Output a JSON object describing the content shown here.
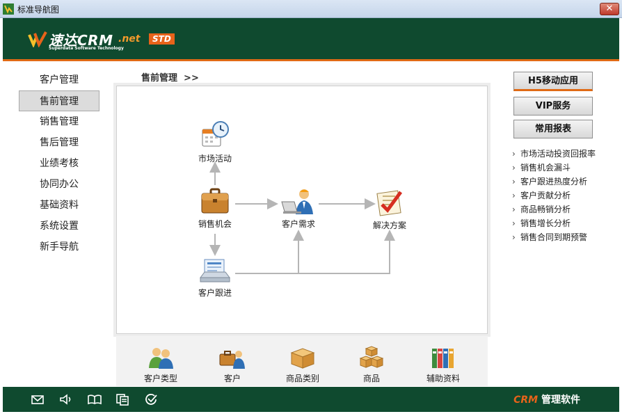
{
  "window": {
    "title": "标准导航图",
    "close_glyph": "✕"
  },
  "header": {
    "brand": "速达CRM",
    "brand_suffix": ".net",
    "edition": "STD",
    "tagline": "Superdata Software Technology"
  },
  "sidebar": {
    "items": [
      {
        "label": "客户管理"
      },
      {
        "label": "售前管理"
      },
      {
        "label": "销售管理"
      },
      {
        "label": "售后管理"
      },
      {
        "label": "业绩考核"
      },
      {
        "label": "协同办公"
      },
      {
        "label": "基础资料"
      },
      {
        "label": "系统设置"
      },
      {
        "label": "新手导航"
      }
    ],
    "active_index": 1
  },
  "breadcrumb": {
    "text": "售前管理  >>"
  },
  "flow": {
    "nodes": [
      {
        "label": "市场活动",
        "icon": "calendar-clock-icon"
      },
      {
        "label": "销售机会",
        "icon": "briefcase-icon"
      },
      {
        "label": "客户需求",
        "icon": "user-laptop-icon"
      },
      {
        "label": "解决方案",
        "icon": "checklist-icon"
      },
      {
        "label": "客户跟进",
        "icon": "document-stack-icon"
      }
    ]
  },
  "shortcuts": [
    {
      "label": "客户类型",
      "icon": "users-icon"
    },
    {
      "label": "客户",
      "icon": "customer-icon"
    },
    {
      "label": "商品类别",
      "icon": "box-icon"
    },
    {
      "label": "商品",
      "icon": "boxes-icon"
    },
    {
      "label": "辅助资料",
      "icon": "binders-icon"
    }
  ],
  "right": {
    "buttons": [
      {
        "label": "H5移动应用"
      },
      {
        "label": "VIP服务"
      },
      {
        "label": "常用报表"
      }
    ],
    "reports": [
      {
        "label": "市场活动投资回报率"
      },
      {
        "label": "销售机会漏斗"
      },
      {
        "label": "客户跟进热度分析"
      },
      {
        "label": "客户贡献分析"
      },
      {
        "label": "商品畅销分析"
      },
      {
        "label": "销售增长分析"
      },
      {
        "label": "销售合同到期预警"
      }
    ],
    "arrow": "›"
  },
  "footer": {
    "icons": [
      "mail-icon",
      "speaker-icon",
      "book-icon",
      "copy-icon",
      "check-circle-icon"
    ],
    "brand_prefix": "CRM",
    "brand_suffix": "管理软件"
  },
  "colors": {
    "dark_green": "#0f4a2f",
    "accent_orange": "#e06a15"
  }
}
